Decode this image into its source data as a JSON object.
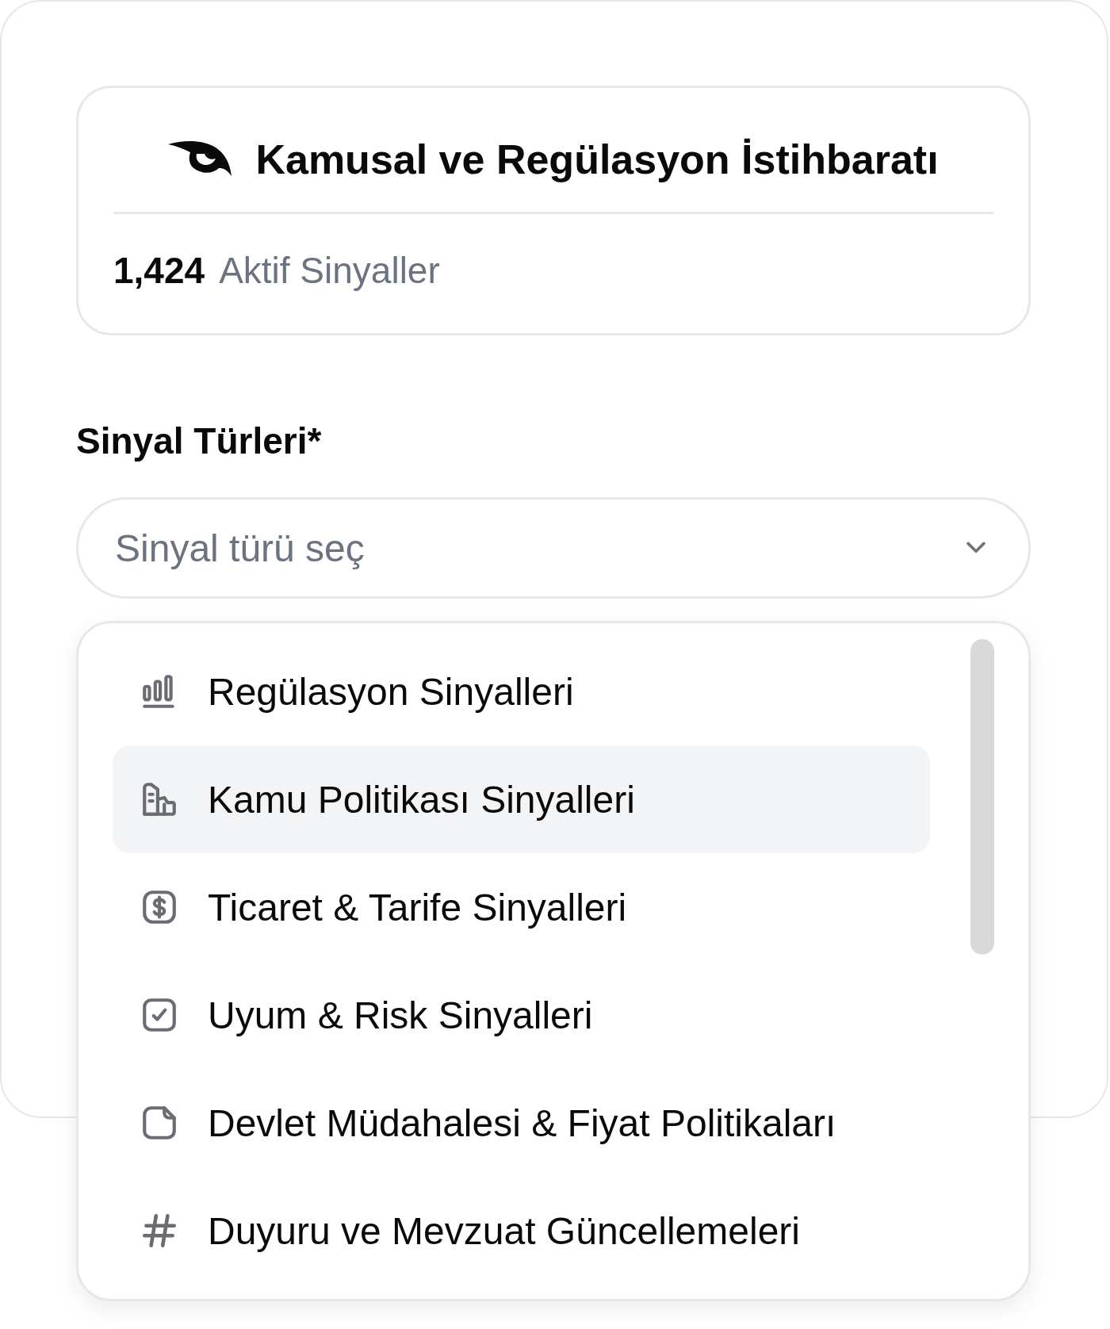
{
  "header": {
    "title": "Kamusal ve Regülasyon İstihbaratı",
    "count": "1,424",
    "count_label": "Aktif Sinyaller"
  },
  "field": {
    "label": "Sinyal Türleri*",
    "placeholder": "Sinyal türü seç",
    "expanded": true
  },
  "options": [
    {
      "label": "Regülasyon Sinyalleri",
      "kind": "bars",
      "selected": false
    },
    {
      "label": "Kamu Politikası Sinyalleri",
      "kind": "building",
      "selected": true
    },
    {
      "label": "Ticaret & Tarife Sinyalleri",
      "kind": "dollar",
      "selected": false
    },
    {
      "label": "Uyum & Risk Sinyalleri",
      "kind": "check",
      "selected": false
    },
    {
      "label": "Devlet Müdahalesi & Fiyat Politikaları",
      "kind": "note",
      "selected": false
    },
    {
      "label": "Duyuru ve Mevzuat Güncellemeleri",
      "kind": "hash",
      "selected": false
    }
  ]
}
